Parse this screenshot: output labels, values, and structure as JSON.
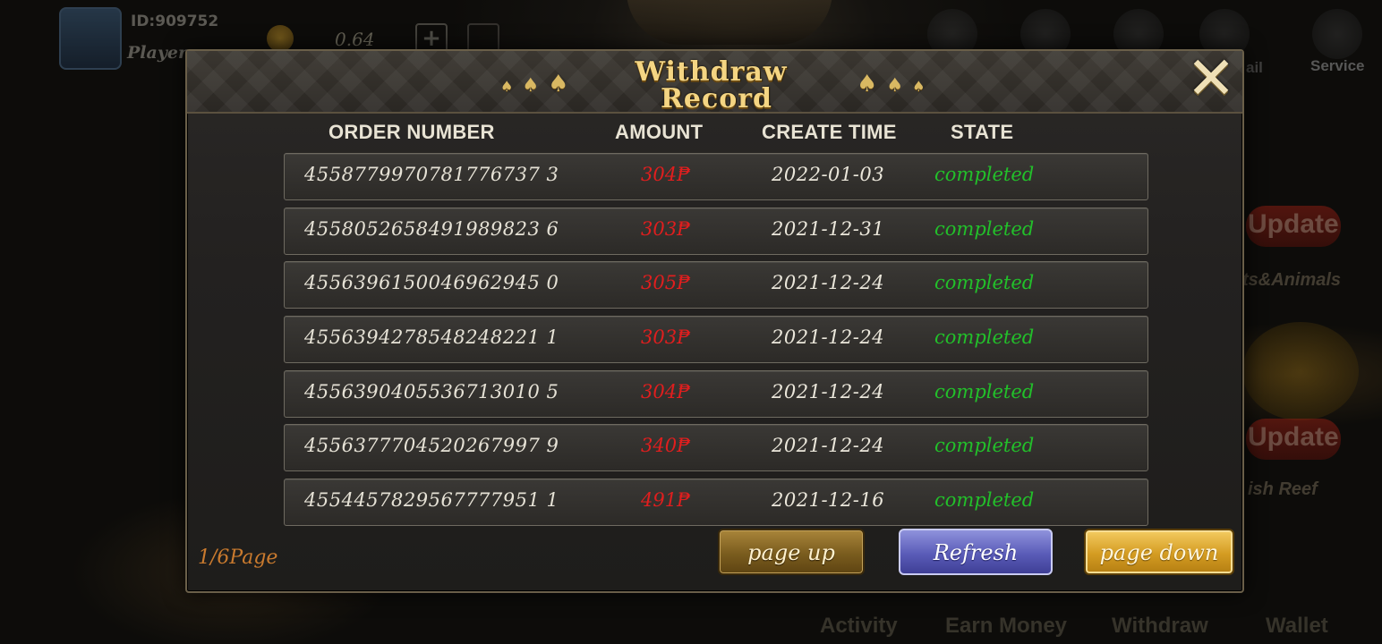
{
  "background": {
    "user_id": "ID:909752",
    "player_name": "Player",
    "balance": "0.64",
    "plus_icon": "plus-icon",
    "service_label": "Service",
    "mail_label": "ail",
    "update_badge": "Update",
    "game1_label": "ts&Animals",
    "game2_label": "ish Reef",
    "nav": [
      "Activity",
      "Earn Money",
      "Withdraw",
      "Wallet"
    ]
  },
  "dialog": {
    "title_line1": "Withdraw",
    "title_line2": "Record",
    "close_icon": "close-icon",
    "columns": {
      "order_number": "ORDER NUMBER",
      "amount": "AMOUNT",
      "create_time": "CREATE TIME",
      "state": "STATE"
    },
    "records": [
      {
        "order": "4558779970781776737 3",
        "amount": "304₱",
        "time": "2022-01-03",
        "state": "completed"
      },
      {
        "order": "4558052658491989823 6",
        "amount": "303₱",
        "time": "2021-12-31",
        "state": "completed"
      },
      {
        "order": "4556396150046962945 0",
        "amount": "305₱",
        "time": "2021-12-24",
        "state": "completed"
      },
      {
        "order": "4556394278548248221 1",
        "amount": "303₱",
        "time": "2021-12-24",
        "state": "completed"
      },
      {
        "order": "4556390405536713010 5",
        "amount": "304₱",
        "time": "2021-12-24",
        "state": "completed"
      },
      {
        "order": "4556377704520267997 9",
        "amount": "340₱",
        "time": "2021-12-24",
        "state": "completed"
      },
      {
        "order": "4554457829567777951 1",
        "amount": "491₱",
        "time": "2021-12-16",
        "state": "completed"
      }
    ],
    "page_indicator": "1/6Page",
    "buttons": {
      "page_up": "page up",
      "refresh": "Refresh",
      "page_down": "page down"
    },
    "colors": {
      "title": "#f4d583",
      "amount": "#e01e1e",
      "state": "#22c02a",
      "page_indicator": "#c97a2e"
    }
  }
}
